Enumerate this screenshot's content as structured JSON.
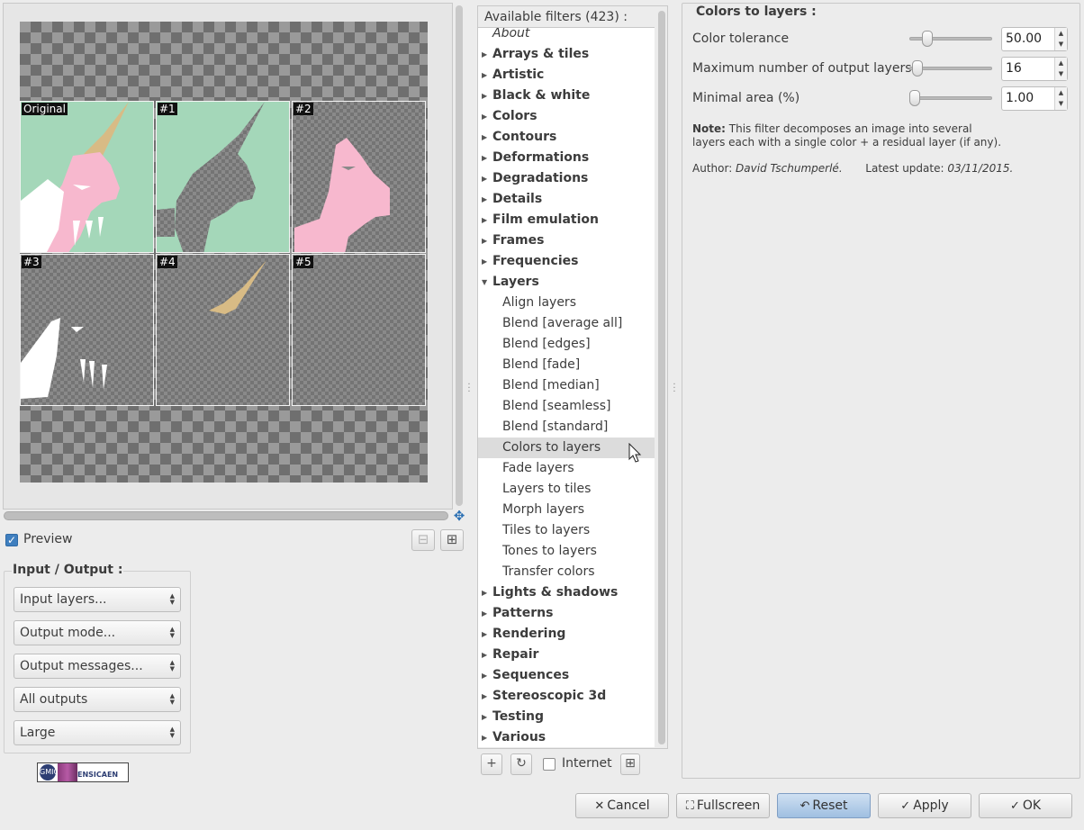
{
  "preview": {
    "tiles": [
      "Original",
      "#1",
      "#2",
      "#3",
      "#4",
      "#5"
    ],
    "checkbox_label": "Preview",
    "checked": true
  },
  "io": {
    "title": "Input / Output :",
    "combos": [
      "Input layers...",
      "Output mode...",
      "Output messages...",
      "All outputs",
      "Large"
    ]
  },
  "logo": {
    "left_text": "GMIC",
    "right_text": "ENSICAEN"
  },
  "filters": {
    "header": "Available filters (423) :",
    "tree": [
      {
        "label": "About",
        "kind": "italic"
      },
      {
        "label": "Arrays & tiles",
        "kind": "cat"
      },
      {
        "label": "Artistic",
        "kind": "cat"
      },
      {
        "label": "Black & white",
        "kind": "cat"
      },
      {
        "label": "Colors",
        "kind": "cat"
      },
      {
        "label": "Contours",
        "kind": "cat"
      },
      {
        "label": "Deformations",
        "kind": "cat"
      },
      {
        "label": "Degradations",
        "kind": "cat"
      },
      {
        "label": "Details",
        "kind": "cat"
      },
      {
        "label": "Film emulation",
        "kind": "cat"
      },
      {
        "label": "Frames",
        "kind": "cat"
      },
      {
        "label": "Frequencies",
        "kind": "cat"
      },
      {
        "label": "Layers",
        "kind": "cat-open"
      },
      {
        "label": "Align layers",
        "kind": "leaf"
      },
      {
        "label": "Blend [average all]",
        "kind": "leaf"
      },
      {
        "label": "Blend [edges]",
        "kind": "leaf"
      },
      {
        "label": "Blend [fade]",
        "kind": "leaf"
      },
      {
        "label": "Blend [median]",
        "kind": "leaf"
      },
      {
        "label": "Blend [seamless]",
        "kind": "leaf"
      },
      {
        "label": "Blend [standard]",
        "kind": "leaf"
      },
      {
        "label": "Colors to layers",
        "kind": "leaf-selected"
      },
      {
        "label": "Fade layers",
        "kind": "leaf"
      },
      {
        "label": "Layers to tiles",
        "kind": "leaf"
      },
      {
        "label": "Morph layers",
        "kind": "leaf"
      },
      {
        "label": "Tiles to layers",
        "kind": "leaf"
      },
      {
        "label": "Tones to layers",
        "kind": "leaf"
      },
      {
        "label": "Transfer colors",
        "kind": "leaf"
      },
      {
        "label": "Lights & shadows",
        "kind": "cat"
      },
      {
        "label": "Patterns",
        "kind": "cat"
      },
      {
        "label": "Rendering",
        "kind": "cat"
      },
      {
        "label": "Repair",
        "kind": "cat"
      },
      {
        "label": "Sequences",
        "kind": "cat"
      },
      {
        "label": "Stereoscopic 3d",
        "kind": "cat"
      },
      {
        "label": "Testing",
        "kind": "cat"
      },
      {
        "label": "Various",
        "kind": "cat"
      }
    ],
    "internet_label": "Internet",
    "internet_checked": false
  },
  "params": {
    "title": "Colors to layers :",
    "rows": [
      {
        "label": "Color tolerance",
        "value": "50.00",
        "fraction": 0.12
      },
      {
        "label": "Maximum number of output layers",
        "value": "16",
        "fraction": 0.0
      },
      {
        "label": "Minimal area (%)",
        "value": "1.00",
        "fraction": 0.0
      }
    ],
    "note_bold": "Note:",
    "note_line1": " This filter decomposes an image into several",
    "note_line2": "layers each with a single color + a residual layer (if any).",
    "author_label": "Author: ",
    "author_name": "David Tschumperlé.",
    "update_label": "Latest update: ",
    "update_date": "03/11/2015."
  },
  "buttons": {
    "cancel": "Cancel",
    "fullscreen": "Fullscreen",
    "reset": "Reset",
    "apply": "Apply",
    "ok": "OK"
  },
  "colors": {
    "mint": "#a4d7b9",
    "pink": "#f7b8ce",
    "horn": "#d8bb85",
    "white": "#ffffff",
    "accent": "#3f7fbf"
  }
}
